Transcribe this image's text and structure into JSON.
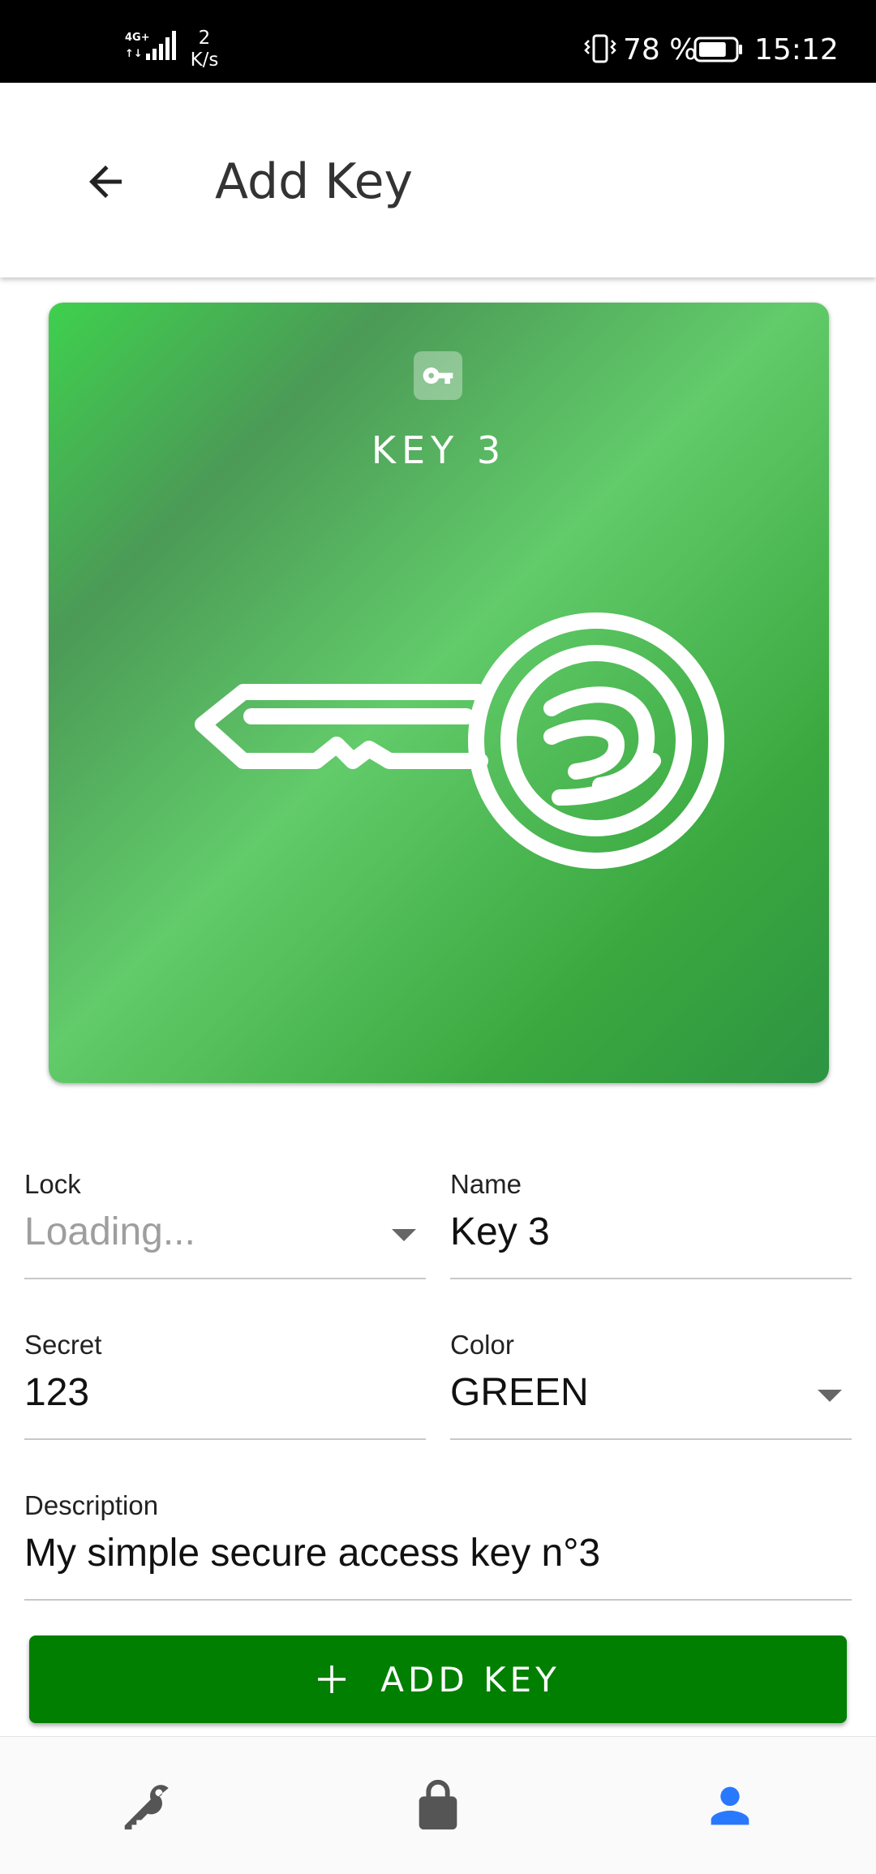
{
  "status_bar": {
    "network": "4G+",
    "speed_value": "2",
    "speed_unit": "K/s",
    "battery_percent": "78 %",
    "battery_level": 0.78,
    "time": "15:12"
  },
  "app_bar": {
    "title": "Add Key",
    "back_icon": "arrow-back-icon"
  },
  "key_card": {
    "title": "KEY 3",
    "badge_icon": "vpn-key-icon",
    "art_icon": "key-illustration",
    "color": "#4caf50"
  },
  "form": {
    "lock": {
      "label": "Lock",
      "placeholder": "Loading..."
    },
    "name": {
      "label": "Name",
      "value": "Key 3"
    },
    "secret": {
      "label": "Secret",
      "value": "123"
    },
    "color": {
      "label": "Color",
      "value": "GREEN"
    },
    "description": {
      "label": "Description",
      "value": "My simple secure access key n°3"
    }
  },
  "add_button": {
    "label": "ADD KEY",
    "icon": "plus-icon",
    "color": "#007f00"
  },
  "bottom_nav": {
    "items": [
      {
        "icon": "key-icon",
        "active": false
      },
      {
        "icon": "lock-icon",
        "active": false
      },
      {
        "icon": "person-icon",
        "active": true
      }
    ],
    "active_color": "#2979ff",
    "inactive_color": "#555555"
  }
}
